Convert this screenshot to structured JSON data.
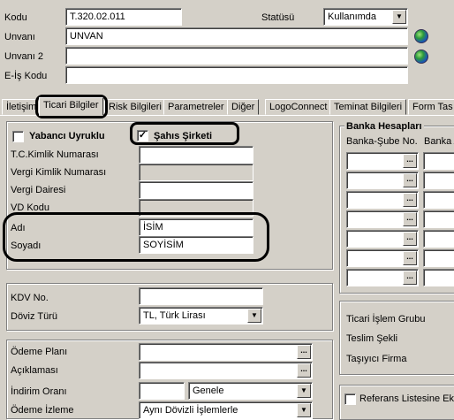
{
  "header": {
    "kod_label": "Kodu",
    "kod_value": "T.320.02.011",
    "statusu_label": "Statüsü",
    "statusu_value": "Kullanımda",
    "unvan_label": "Unvanı",
    "unvan_value": "UNVAN",
    "unvan2_label": "Unvanı 2",
    "unvan2_value": "",
    "eis_label": "E-İş Kodu",
    "eis_value": ""
  },
  "tabs": [
    {
      "label": "İletişim"
    },
    {
      "label": "Ticari Bilgiler"
    },
    {
      "label": "Risk Bilgileri"
    },
    {
      "label": "Parametreler"
    },
    {
      "label": "Diğer"
    },
    {
      "label": "LogoConnect"
    },
    {
      "label": "Teminat Bilgileri"
    },
    {
      "label": "Form Tas"
    }
  ],
  "ticari": {
    "yabanci_label": "Yabancı Uyruklu",
    "yabanci_checked": false,
    "sahis_label": "Şahıs Şirketi",
    "sahis_checked": true,
    "tc_label": "T.C.Kimlik Numarası",
    "vkn_label": "Vergi Kimlik Numarası",
    "vd_label": "Vergi Dairesi",
    "vdkod_label": "VD Kodu",
    "adi_label": "Adı",
    "adi_value": "İSİM",
    "soyadi_label": "Soyadı",
    "soyadi_value": "SOYİSİM"
  },
  "kdv": {
    "kdv_label": "KDV No.",
    "doviz_label": "Döviz Türü",
    "doviz_value": "TL, Türk Lirası"
  },
  "odeme": {
    "plan_label": "Ödeme Planı",
    "aciklama_label": "Açıklaması",
    "indirim_label": "İndirim Oranı",
    "indirim_select": "Genele",
    "izleme_label": "Ödeme İzleme",
    "izleme_value": "Aynı Dövizli İşlemlerle"
  },
  "banka": {
    "title": "Banka Hesapları",
    "col1": "Banka-Şube No.",
    "col2": "Banka A"
  },
  "right_labels": {
    "ticari_islem": "Ticari İşlem Grubu",
    "teslim": "Teslim Şekli",
    "tasiyici": "Taşıyıcı Firma"
  },
  "referans_label": "Referans Listesine Ekle",
  "icons": [
    "globe-icon",
    "ellipsis-icon",
    "chevron-down-icon",
    "checkmark-icon"
  ]
}
